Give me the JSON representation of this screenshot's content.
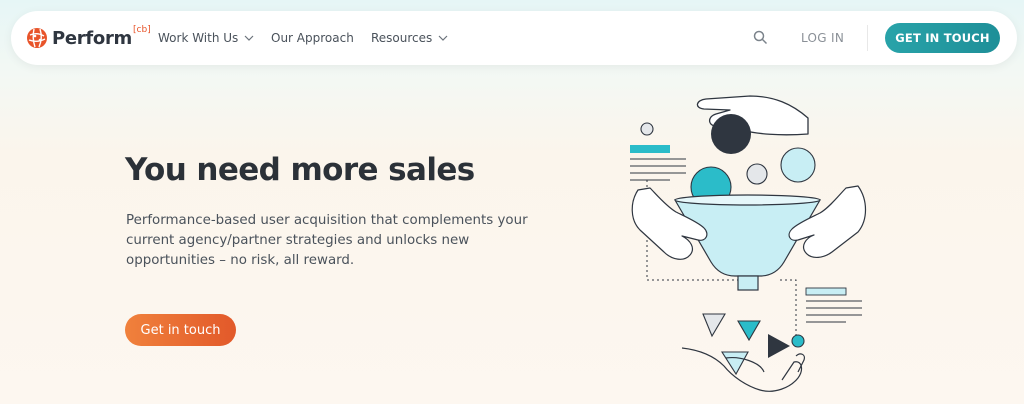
{
  "brand": {
    "name": "Perform",
    "superscript": "[cb]",
    "accent": "#e8542a"
  },
  "nav": {
    "items": [
      {
        "label": "Work With Us",
        "has_dropdown": true
      },
      {
        "label": "Our Approach",
        "has_dropdown": false
      },
      {
        "label": "Resources",
        "has_dropdown": true
      }
    ],
    "search_icon": "search-icon",
    "login_label": "LOG IN",
    "cta_label": "GET IN TOUCH",
    "cta_color": "#28a3a9"
  },
  "hero": {
    "title": "You need more sales",
    "subtitle": "Performance-based user acquisition that complements your current agency/partner strategies and unlocks new opportunities – no risk, all reward.",
    "cta_label": "Get in touch",
    "cta_color": "#ec6e33"
  },
  "illustration": {
    "name": "sales-funnel-illustration",
    "colors": {
      "teal": "#2bbcc9",
      "light_blue": "#c8eef4",
      "dark": "#2f3640",
      "grey": "#dfe2e5"
    }
  }
}
